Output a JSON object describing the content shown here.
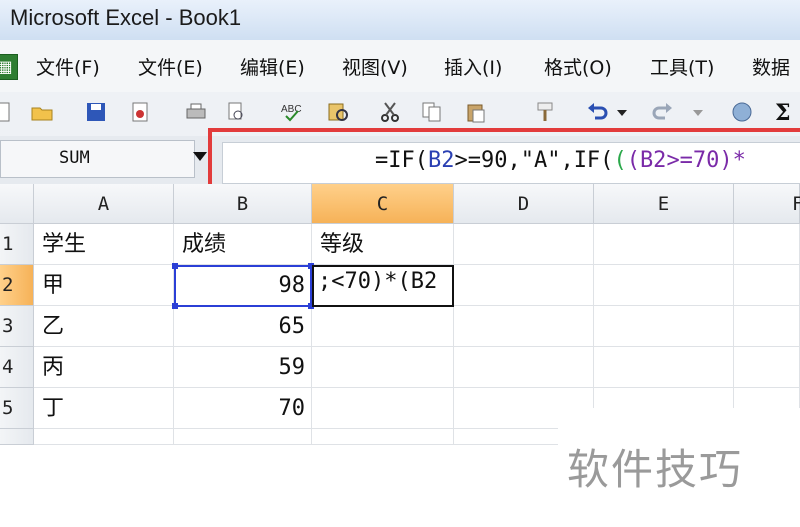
{
  "window": {
    "title": "Microsoft Excel - Book1"
  },
  "menu": {
    "items": [
      "文件(F)",
      "文件(E)",
      "编辑(E)",
      "视图(V)",
      "插入(I)",
      "格式(O)",
      "工具(T)",
      "数据"
    ]
  },
  "formula_bar": {
    "name_box": "SUM",
    "formula": {
      "p1": "=IF(",
      "p2": "B2",
      "p3": ">=90,\"A\",IF(",
      "p4": "(",
      "p5": "(",
      "p6": "B2",
      "p7": ">=70)*"
    }
  },
  "columns": [
    "A",
    "B",
    "C",
    "D",
    "E",
    "F"
  ],
  "rows": [
    "1",
    "2",
    "3",
    "4",
    "5"
  ],
  "cells": {
    "A1": "学生",
    "B1": "成绩",
    "C1": "等级",
    "A2": "甲",
    "B2": "98",
    "C2": ";<70)*(B2",
    "A3": "乙",
    "B3": "65",
    "A4": "丙",
    "B4": "59",
    "A5": "丁",
    "B5": "70"
  },
  "watermark": "软件技巧",
  "colors": {
    "highlight": "#e23b3b",
    "selection": "#2b3fd6",
    "active_header": "#f6b258"
  },
  "icons": [
    "new-icon",
    "open-icon",
    "save-icon",
    "permission-icon",
    "print-icon",
    "print-preview-icon",
    "spelling-icon",
    "research-icon",
    "cut-icon",
    "copy-icon",
    "paste-icon",
    "format-painter-icon",
    "undo-icon",
    "redo-icon",
    "hyperlink-icon",
    "autosum-icon"
  ]
}
